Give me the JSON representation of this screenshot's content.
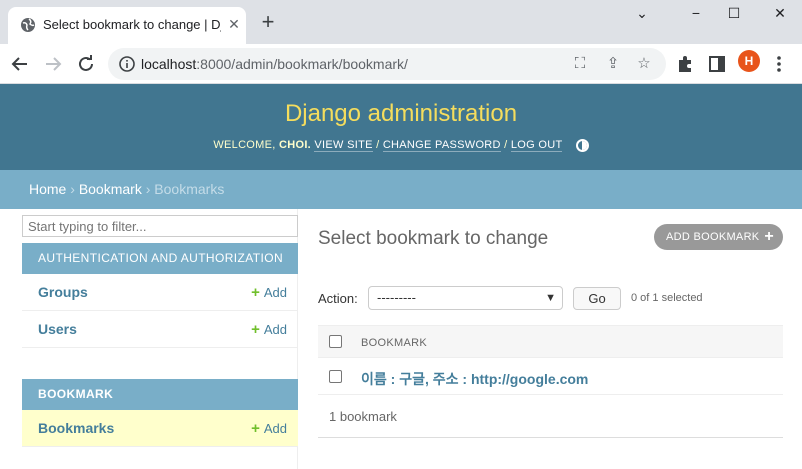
{
  "browser": {
    "tab_title": "Select bookmark to change | Django",
    "new_tab": "+",
    "window_minimize": "−",
    "window_maximize": "☐",
    "window_close": "✕",
    "url_host": "localhost",
    "url_rest": ":8000/admin/bookmark/bookmark/",
    "profile_initial": "H"
  },
  "header": {
    "brand": "Django administration",
    "welcome": "WELCOME,",
    "user": "CHOI.",
    "view_site": "VIEW SITE",
    "change_password": "CHANGE PASSWORD",
    "log_out": "LOG OUT",
    "sep": "/"
  },
  "breadcrumbs": {
    "home": "Home",
    "app": "Bookmark",
    "current": "Bookmarks",
    "sep": "›"
  },
  "sidebar": {
    "filter_placeholder": "Start typing to filter...",
    "modules": [
      {
        "caption": "AUTHENTICATION AND AUTHORIZATION",
        "rows": [
          {
            "name": "Groups",
            "add": "Add"
          },
          {
            "name": "Users",
            "add": "Add"
          }
        ]
      },
      {
        "caption": "BOOKMARK",
        "rows": [
          {
            "name": "Bookmarks",
            "add": "Add"
          }
        ]
      }
    ]
  },
  "content": {
    "title": "Select bookmark to change",
    "add_button": "ADD BOOKMARK",
    "action_label": "Action:",
    "action_value": "---------",
    "go": "Go",
    "selected_count": "0 of 1 selected",
    "column_header": "BOOKMARK",
    "rows": [
      "이름 : 구글, 주소 : http://google.com"
    ],
    "paginator": "1 bookmark"
  },
  "colors": {
    "header_bg": "#417690",
    "brand": "#f5dd5d",
    "breadcrumb_bg": "#79aec8",
    "link": "#447e9b",
    "add_green": "#70bf2b",
    "selected_row": "#ffffcc"
  }
}
